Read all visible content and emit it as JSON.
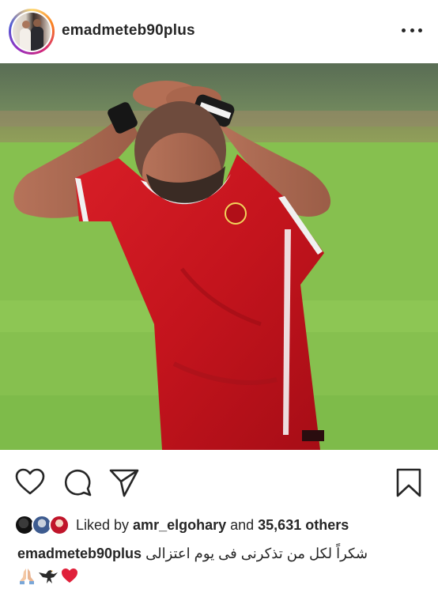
{
  "post": {
    "username": "emadmeteb90plus",
    "more_icon": "more-horizontal-icon"
  },
  "photo": {
    "subject": "player in red jersey holding head on football pitch"
  },
  "actions": {
    "like_icon": "heart-outline-icon",
    "comment_icon": "comment-bubble-icon",
    "share_icon": "paper-plane-icon",
    "save_icon": "bookmark-outline-icon"
  },
  "likes": {
    "prefix": "Liked by ",
    "user": "amr_elgohary",
    "connector": " and ",
    "count": "35,631 others"
  },
  "caption": {
    "user": "emadmeteb90plus",
    "text": "شكراً لكل من تذكرنى فى يوم اعتزالى",
    "emojis": [
      "pray-emoji",
      "eagle-emoji",
      "red-heart-emoji"
    ]
  },
  "colors": {
    "text": "#262626",
    "jersey_red": "#c8151f",
    "pitch_green": "#8cc452",
    "heart_red": "#e0203a"
  }
}
